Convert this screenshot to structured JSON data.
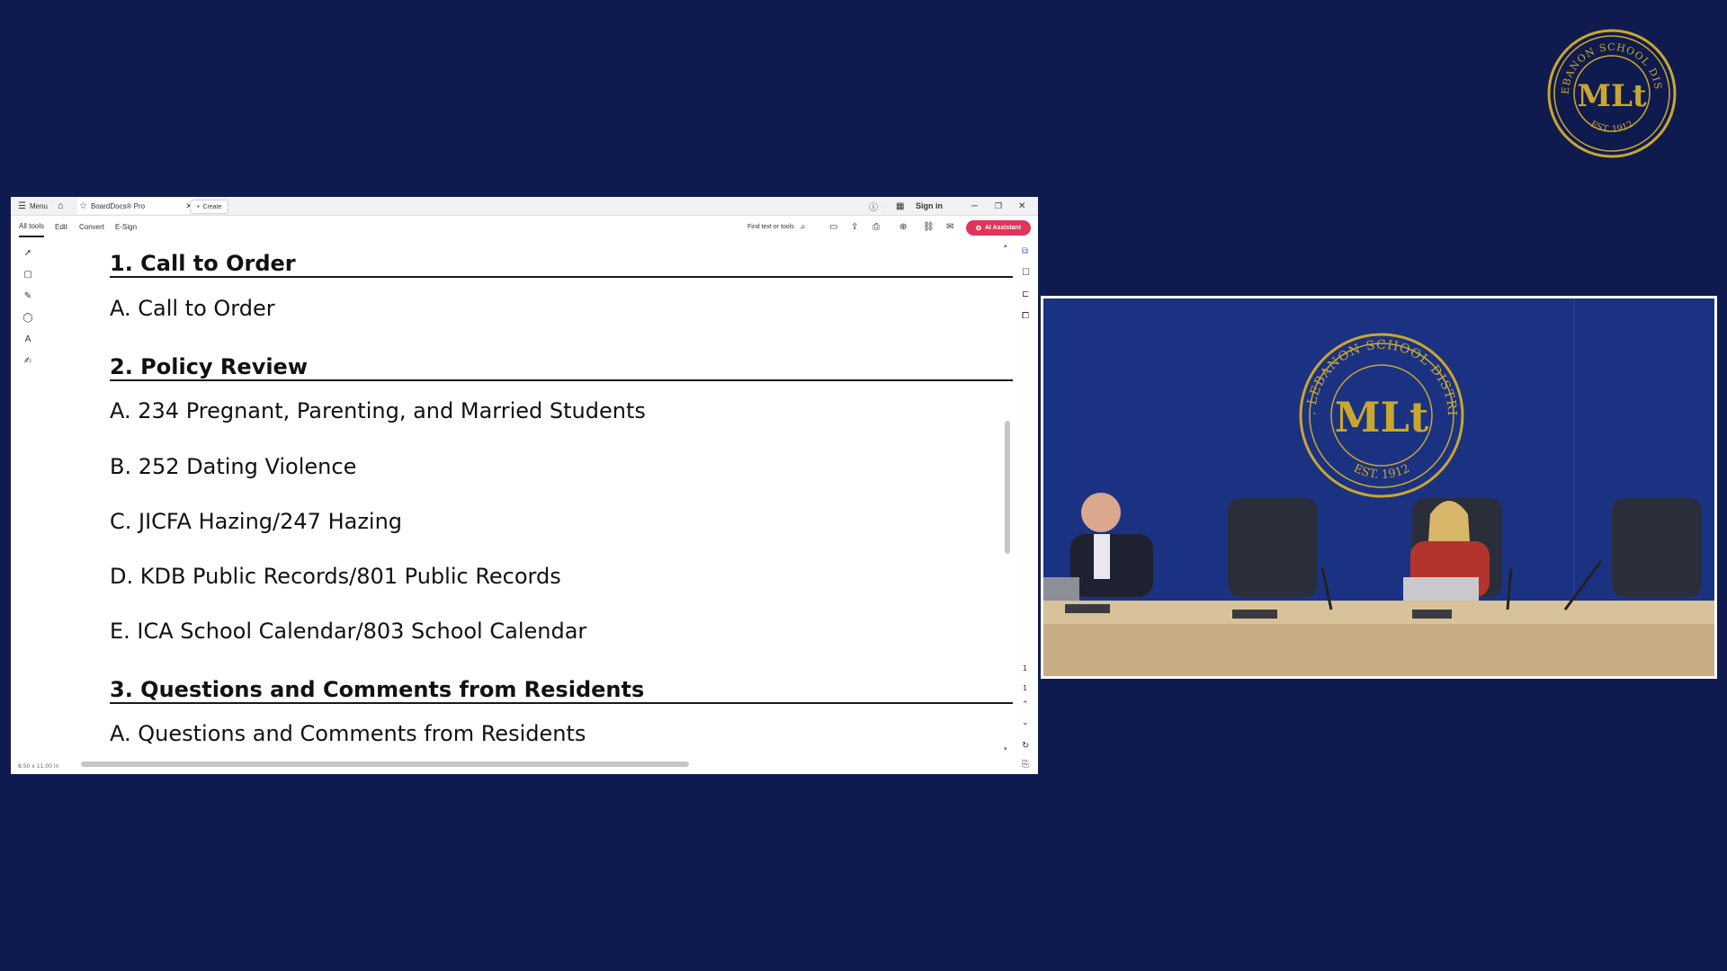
{
  "seal": {
    "text_top": "MT. LEBANON SCHOOL DISTRICT",
    "text_bottom": "EST. 1912",
    "monogram": "MLt"
  },
  "titlebar": {
    "menu_label": "Menu",
    "tab_title": "BoardDocs® Pro",
    "create_label": "Create",
    "sign_in": "Sign in"
  },
  "toolbar": {
    "tabs": [
      "All tools",
      "Edit",
      "Convert",
      "E-Sign"
    ],
    "find_placeholder": "Find text or tools",
    "ai_label": "AI Assistant"
  },
  "status": {
    "page_size": "8.50 x 11.00 in"
  },
  "agenda": {
    "sections": [
      {
        "title": "1. Call to Order",
        "items": [
          "A. Call to Order"
        ]
      },
      {
        "title": "2. Policy Review",
        "items": [
          "A. 234 Pregnant, Parenting, and Married Students",
          "B. 252 Dating Violence",
          "C. JICFA Hazing/247 Hazing",
          "D. KDB Public Records/801 Public Records",
          "E. ICA School Calendar/803 School Calendar"
        ]
      },
      {
        "title": "3. Questions and Comments from Residents",
        "items": [
          "A. Questions and Comments from Residents"
        ]
      }
    ]
  },
  "colors": {
    "background": "#0f1b4f",
    "gold": "#c9a72f",
    "ai_button": "#e0345a",
    "video_wall": "#1b3282"
  }
}
